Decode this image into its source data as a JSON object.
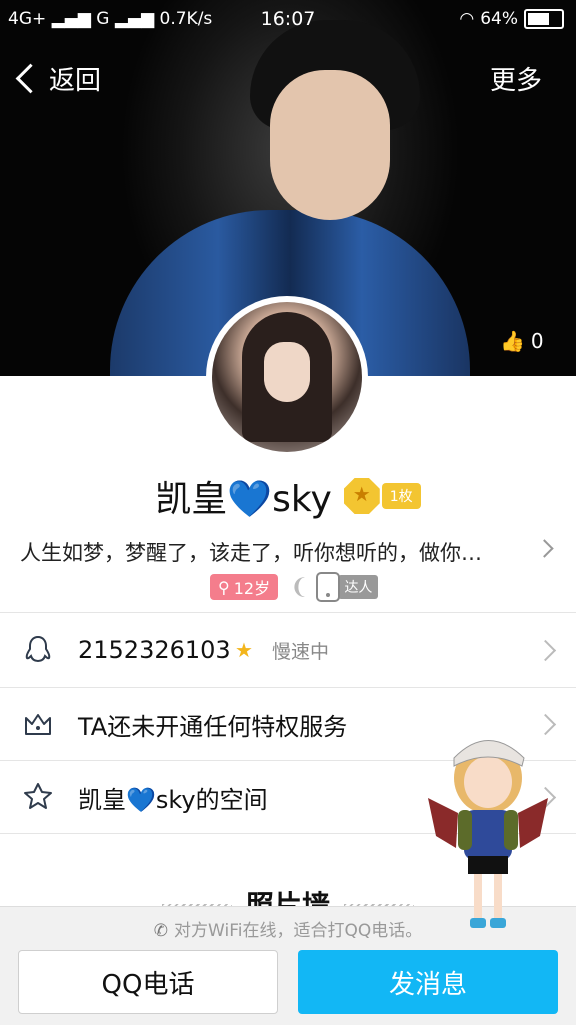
{
  "status_bar": {
    "network": "4G+",
    "signal2": "G",
    "speed": "0.7K/s",
    "time": "16:07",
    "battery": "64%"
  },
  "nav": {
    "back_label": "返回",
    "more_label": "更多"
  },
  "cover": {
    "like_count": "0"
  },
  "profile": {
    "name_prefix": "凯皇",
    "name_heart": "💙",
    "name_suffix": "sky",
    "medal_count": "1枚",
    "signature": "人生如梦，梦醒了，该走了，听你想听的，做你…",
    "age_tag": "12岁",
    "talent_label": "达人"
  },
  "rows": [
    {
      "text": "2152326103",
      "extra": "慢速中"
    },
    {
      "text": "TA还未开通任何特权服务"
    },
    {
      "text": "凯皇💙sky的空间"
    }
  ],
  "photo_wall": {
    "title": "照片墙"
  },
  "bottom": {
    "hint": "对方WiFi在线，适合打QQ电话。",
    "call_label": "QQ电话",
    "message_label": "发消息"
  },
  "colors": {
    "accent": "#12b7f5",
    "medal": "#f3c531",
    "age_tag": "#f47d8c"
  }
}
